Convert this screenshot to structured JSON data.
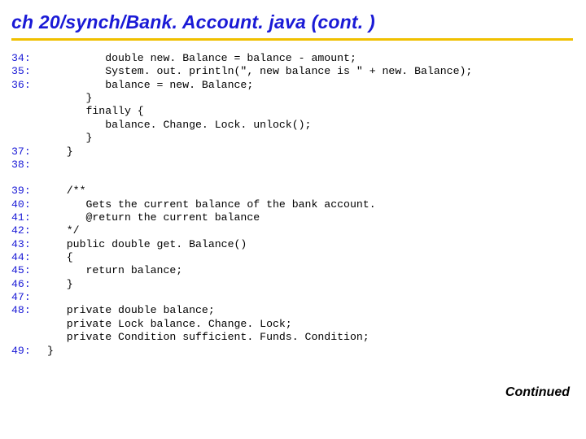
{
  "title": "ch 20/synch/Bank. Account. java  (cont. )",
  "continued_label": "Continued",
  "lines": [
    {
      "num": "34:",
      "code": "         double new. Balance = balance - amount;"
    },
    {
      "num": "35:",
      "code": "         System. out. println(\", new balance is \" + new. Balance);"
    },
    {
      "num": "36:",
      "code": "         balance = new. Balance;"
    },
    {
      "num": "",
      "code": "      }"
    },
    {
      "num": "",
      "code": "      finally {"
    },
    {
      "num": "",
      "code": "         balance. Change. Lock. unlock();"
    },
    {
      "num": "",
      "code": "      }"
    },
    {
      "num": "37:",
      "code": "   }"
    },
    {
      "num": "38:",
      "code": ""
    },
    {
      "blank": true
    },
    {
      "num": "39:",
      "code": "   /**"
    },
    {
      "num": "40:",
      "code": "      Gets the current balance of the bank account."
    },
    {
      "num": "41:",
      "code": "      @return the current balance"
    },
    {
      "num": "42:",
      "code": "   */"
    },
    {
      "num": "43:",
      "code": "   public double get. Balance()"
    },
    {
      "num": "44:",
      "code": "   {"
    },
    {
      "num": "45:",
      "code": "      return balance;"
    },
    {
      "num": "46:",
      "code": "   }"
    },
    {
      "num": "47:",
      "code": ""
    },
    {
      "num": "48:",
      "code": "   private double balance;"
    },
    {
      "num": "",
      "code": "   private Lock balance. Change. Lock;"
    },
    {
      "num": "",
      "code": "   private Condition sufficient. Funds. Condition;"
    },
    {
      "num": "49:",
      "code": "}"
    }
  ]
}
